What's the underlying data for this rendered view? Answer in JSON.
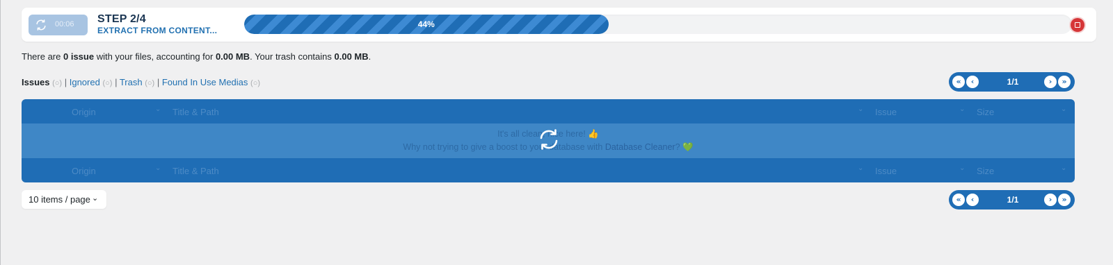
{
  "progress": {
    "timer": "00:06",
    "step_title": "STEP 2/4",
    "step_subtitle": "EXTRACT FROM CONTENT...",
    "percent_label": "44%",
    "percent": 44
  },
  "summary": {
    "prefix": "There are ",
    "issue_count": "0 issue",
    "middle": " with your files, accounting for ",
    "size": "0.00 MB",
    "middle2": ". Your trash contains ",
    "trash_size": "0.00 MB",
    "suffix": "."
  },
  "filters": {
    "issues": "Issues",
    "ignored": "Ignored",
    "trash": "Trash",
    "found_in_use": "Found In Use Medias",
    "separator": "|",
    "bubble_icon": "comment-bubble-icon"
  },
  "pagination": {
    "page_label": "1/1",
    "first": "«",
    "prev": "‹",
    "next": "›",
    "last": "»"
  },
  "table": {
    "columns": [
      "Origin",
      "Title & Path",
      "Issue",
      "Size"
    ],
    "empty_line1": "It's all clean, nice here! 👍",
    "empty_line2_prefix": "Why not trying to give a boost to your database with ",
    "empty_line2_link": "Database Cleaner",
    "empty_line2_suffix": "? 💚"
  },
  "per_page": {
    "label": "10 items / page"
  },
  "colors": {
    "accent": "#1f6db5",
    "stop": "#d63638",
    "link": "#2271b1"
  }
}
